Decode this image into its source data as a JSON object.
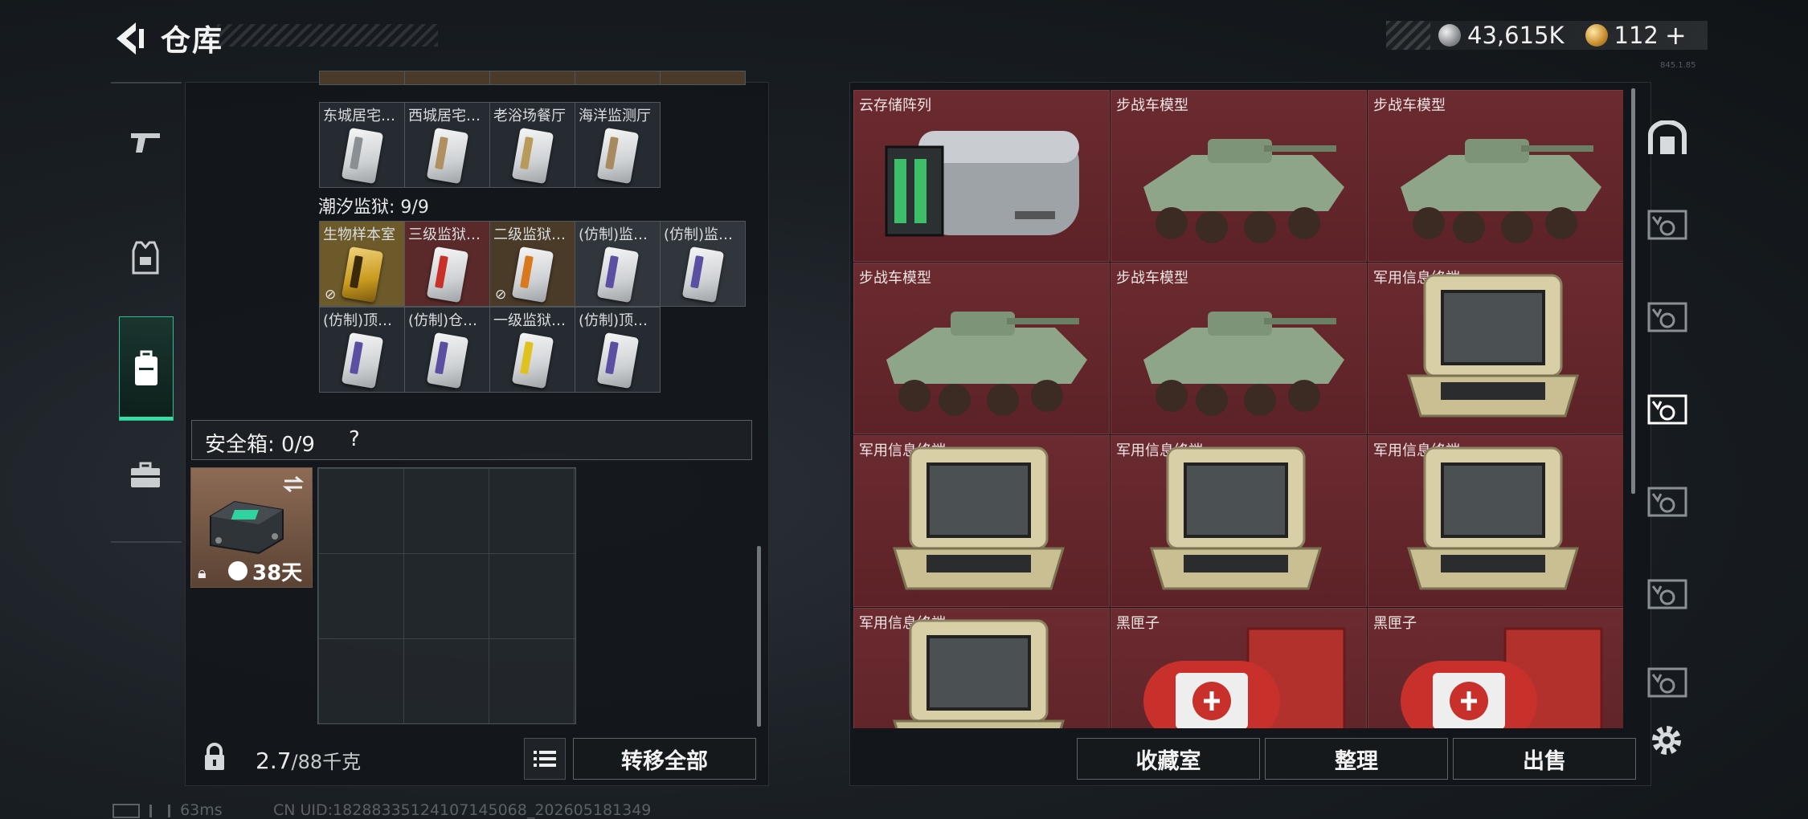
{
  "header": {
    "title": "仓库",
    "currency1": "43,615K",
    "currency2": "112",
    "plus": "+",
    "version": "845.1.85"
  },
  "left_rail": [
    {
      "name": "weapons-tab",
      "icon": "pistol-icon"
    },
    {
      "name": "armor-tab",
      "icon": "vest-icon"
    },
    {
      "name": "backpack-tab",
      "icon": "backpack-icon"
    },
    {
      "name": "case-tab",
      "icon": "briefcase-icon"
    }
  ],
  "keycards_top": [
    {
      "label": "东城居宅…"
    },
    {
      "label": "西城居宅…"
    },
    {
      "label": "老浴场餐厅"
    },
    {
      "label": "海洋监测厅"
    }
  ],
  "prison_section": {
    "title": "潮汐监狱: 9/9",
    "cards": [
      {
        "label": "生物样本室",
        "stripe": "#c99a1e",
        "nobox": true,
        "bg": "#6d5a2a"
      },
      {
        "label": "三级监狱…",
        "stripe": "#c8302a",
        "nobox": false,
        "bg": "#5a2a2a"
      },
      {
        "label": "二级监狱…",
        "stripe": "#d9781c",
        "nobox": true,
        "bg": "#4a3a28"
      },
      {
        "label": "(仿制)监…",
        "stripe": "#5a4fa0",
        "nobox": false,
        "bg": "#31363c"
      },
      {
        "label": "(仿制)监…",
        "stripe": "#5a4fa0",
        "nobox": false,
        "bg": "#31363c"
      },
      {
        "label": "(仿制)顶…",
        "stripe": "#5a4fa0",
        "nobox": false,
        "bg": "#252b31"
      },
      {
        "label": "(仿制)仓…",
        "stripe": "#5a4fa0",
        "nobox": false,
        "bg": "#252b31"
      },
      {
        "label": "一级监狱…",
        "stripe": "#e0c21f",
        "nobox": false,
        "bg": "#252b31"
      },
      {
        "label": "(仿制)顶…",
        "stripe": "#5a4fa0",
        "nobox": false,
        "bg": "#252b31"
      }
    ]
  },
  "safebox": {
    "title": "安全箱: 0/9",
    "help": "?",
    "timer": "38天"
  },
  "footer_left": {
    "weight_value": "2.7",
    "weight_unit": "/88千克",
    "transfer_all": "转移全部"
  },
  "items": [
    {
      "name": "云存储阵列",
      "kind": "server"
    },
    {
      "name": "步战车模型",
      "kind": "vehicle"
    },
    {
      "name": "步战车模型",
      "kind": "vehicle"
    },
    {
      "name": "步战车模型",
      "kind": "vehicle"
    },
    {
      "name": "步战车模型",
      "kind": "vehicle"
    },
    {
      "name": "军用信息终端",
      "kind": "terminal"
    },
    {
      "name": "军用信息终端",
      "kind": "terminal"
    },
    {
      "name": "军用信息终端",
      "kind": "terminal"
    },
    {
      "name": "军用信息终端",
      "kind": "terminal"
    },
    {
      "name": "军用信息终端",
      "kind": "terminal"
    },
    {
      "name": "黑匣子",
      "kind": "blackbox"
    },
    {
      "name": "黑匣子",
      "kind": "blackbox"
    }
  ],
  "footer_right": {
    "collection": "收藏室",
    "sort": "整理",
    "sell": "出售"
  },
  "right_tabs": [
    {
      "icon": "vault-icon",
      "active": false
    },
    {
      "icon": "storage-icon",
      "active": false
    },
    {
      "icon": "storage-icon",
      "active": false
    },
    {
      "icon": "storage-icon",
      "active": true
    },
    {
      "icon": "storage-icon",
      "active": false
    },
    {
      "icon": "storage-icon",
      "active": false
    },
    {
      "icon": "storage-icon",
      "active": false
    }
  ],
  "status": {
    "ping": "63ms",
    "uid": "CN UID:18288335124107145068_202605181349"
  },
  "colors": {
    "accent": "#35e0a8",
    "item_bg": "#6b2b30"
  }
}
